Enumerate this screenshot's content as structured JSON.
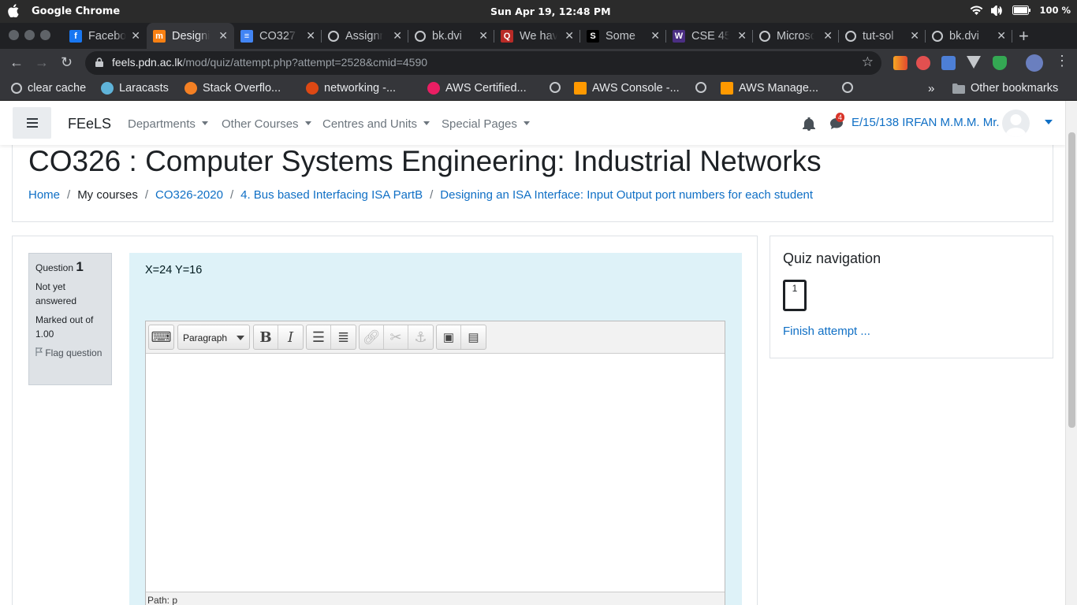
{
  "os": {
    "app_name": "Google Chrome",
    "clock": "Sun Apr 19, 12:48 PM",
    "battery": "100 %"
  },
  "tabs": [
    {
      "title": "Facebook",
      "icon": "facebook-icon",
      "color": "#1877f2",
      "glyph": "f"
    },
    {
      "title": "Designing",
      "icon": "moodle-icon",
      "color": "#f98012",
      "glyph": "m",
      "active": true
    },
    {
      "title": "CO327",
      "icon": "docs-icon",
      "color": "#4285f4",
      "glyph": "≡"
    },
    {
      "title": "Assignment",
      "icon": "globe-icon",
      "color": "#c5c8cc",
      "glyph": ""
    },
    {
      "title": "bk.dvi",
      "icon": "globe-icon",
      "color": "#c5c8cc",
      "glyph": ""
    },
    {
      "title": "We have",
      "icon": "quora-icon",
      "color": "#b92b27",
      "glyph": "Q"
    },
    {
      "title": "Some",
      "icon": "scribd-icon",
      "color": "#000000",
      "glyph": "S"
    },
    {
      "title": "CSE 45",
      "icon": "uw-icon",
      "color": "#4b2e83",
      "glyph": "W"
    },
    {
      "title": "Microsoft",
      "icon": "globe-icon",
      "color": "#c5c8cc",
      "glyph": ""
    },
    {
      "title": "tut-sol",
      "icon": "globe-icon",
      "color": "#c5c8cc",
      "glyph": ""
    },
    {
      "title": "bk.dvi",
      "icon": "globe-icon",
      "color": "#c5c8cc",
      "glyph": ""
    }
  ],
  "address": {
    "host": "feels.pdn.ac.lk",
    "path": "/mod/quiz/attempt.php?attempt=2528&cmid=4590"
  },
  "bookmarks": [
    {
      "label": "clear cache",
      "icon": "gear-icon",
      "color": "#c5c8cc"
    },
    {
      "label": "Laracasts",
      "icon": "laracasts-icon",
      "color": "#5fb3d9"
    },
    {
      "label": "Stack Overflo...",
      "icon": "stackoverflow-icon",
      "color": "#f48024"
    },
    {
      "label": "networking -...",
      "icon": "askubuntu-icon",
      "color": "#dd4814"
    },
    {
      "label": "AWS Certified...",
      "icon": "aws-icon",
      "color": "#e91e63"
    },
    {
      "label": "",
      "icon": "globe-icon",
      "color": "#c5c8cc"
    },
    {
      "label": "AWS Console -...",
      "icon": "aws-cube-icon",
      "color": "#ff9900"
    },
    {
      "label": "",
      "icon": "globe-icon",
      "color": "#c5c8cc"
    },
    {
      "label": "AWS Manage...",
      "icon": "aws-cube-icon",
      "color": "#ff9900"
    },
    {
      "label": "",
      "icon": "globe-icon",
      "color": "#c5c8cc"
    }
  ],
  "bookmarks_more": "»",
  "other_bookmarks": "Other bookmarks",
  "site": {
    "brand": "FEeLS",
    "menus": [
      "Departments",
      "Other Courses",
      "Centres and Units",
      "Special Pages"
    ],
    "message_count": "4",
    "user": "E/15/138 IRFAN M.M.M. Mr."
  },
  "course": {
    "title": "CO326 : Computer Systems Engineering: Industrial Networks",
    "breadcrumb": [
      "Home",
      "My courses",
      "CO326-2020",
      "4. Bus based Interfacing ISA PartB",
      "Designing an ISA Interface: Input Output port numbers for each student"
    ]
  },
  "question": {
    "label": "Question",
    "number": "1",
    "status": "Not yet answered",
    "marks": "Marked out of 1.00",
    "flag": "Flag question",
    "text": "X=24 Y=16"
  },
  "editor": {
    "format": "Paragraph",
    "path": "Path: p"
  },
  "quiz_nav": {
    "title": "Quiz navigation",
    "button": "1",
    "finish": "Finish attempt ..."
  }
}
